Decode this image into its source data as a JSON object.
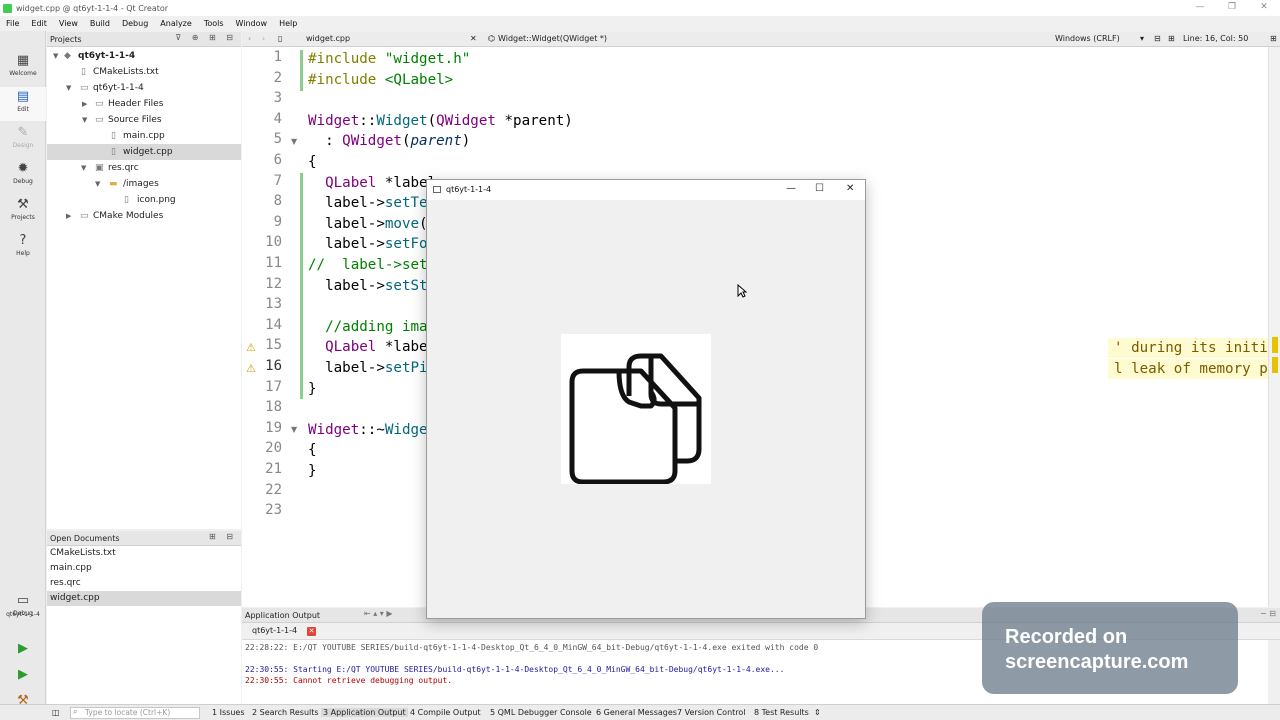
{
  "window": {
    "title": "widget.cpp @ qt6yt-1-1-4 - Qt Creator"
  },
  "menu": [
    "File",
    "Edit",
    "View",
    "Build",
    "Debug",
    "Analyze",
    "Tools",
    "Window",
    "Help"
  ],
  "modes": [
    {
      "label": "Welcome",
      "icon": "grid-icon"
    },
    {
      "label": "Edit",
      "icon": "document-icon"
    },
    {
      "label": "Design",
      "icon": "pencil-icon"
    },
    {
      "label": "Debug",
      "icon": "bug-icon"
    },
    {
      "label": "Projects",
      "icon": "wrench-icon"
    },
    {
      "label": "Help",
      "icon": "help-icon"
    }
  ],
  "kit": {
    "label": "qt6yt-1-1-4",
    "debug_label": "Debug"
  },
  "projects": {
    "header": "Projects",
    "tree": [
      {
        "label": "qt6yt-1-1-4"
      },
      {
        "label": "CMakeLists.txt"
      },
      {
        "label": "qt6yt-1-1-4"
      },
      {
        "label": "Header Files"
      },
      {
        "label": "Source Files"
      },
      {
        "label": "main.cpp"
      },
      {
        "label": "widget.cpp"
      },
      {
        "label": "res.qrc"
      },
      {
        "label": "/images"
      },
      {
        "label": "icon.png"
      },
      {
        "label": "CMake Modules"
      }
    ]
  },
  "open_documents": {
    "header": "Open Documents",
    "items": [
      "CMakeLists.txt",
      "main.cpp",
      "res.qrc",
      "widget.cpp"
    ]
  },
  "editor": {
    "file": "widget.cpp",
    "symbol": "Widget::Widget(QWidget *)",
    "encoding": "Windows (CRLF)",
    "position": "Line: 16, Col: 50",
    "line_numbers": [
      "1",
      "2",
      "3",
      "4",
      "5",
      "6",
      "7",
      "8",
      "9",
      "10",
      "11",
      "12",
      "13",
      "14",
      "15",
      "16",
      "17",
      "18",
      "19",
      "20",
      "21",
      "22",
      "23"
    ],
    "warnings": [
      "' during its initialization is never read [cl…",
      "l leak of memory pointed to by 'label2' [clan…"
    ]
  },
  "app_window": {
    "title": "qt6yt-1-1-4"
  },
  "output": {
    "header": "Application Output",
    "tab": "qt6yt-1-1-4",
    "lines": [
      "22:28:22: E:/QT YOUTUBE SERIES/build-qt6yt-1-1-4-Desktop_Qt_6_4_0_MinGW_64_bit-Debug/qt6yt-1-1-4.exe exited with code 0",
      "22:30:55: Starting E:/QT YOUTUBE SERIES/build-qt6yt-1-1-4-Desktop_Qt_6_4_0_MinGW_64_bit-Debug/qt6yt-1-1-4.exe...",
      "22:30:55: Cannot retrieve debugging output."
    ]
  },
  "statusbar": {
    "locator_placeholder": "Type to locate (Ctrl+K)",
    "items": [
      "1 Issues",
      "2 Search Results",
      "3 Application Output",
      "4 Compile Output",
      "5 QML Debugger Console",
      "6 General Messages",
      "7 Version Control",
      "8 Test Results"
    ]
  },
  "watermark": {
    "line1": "Recorded on",
    "line2": "screencapture.com"
  }
}
